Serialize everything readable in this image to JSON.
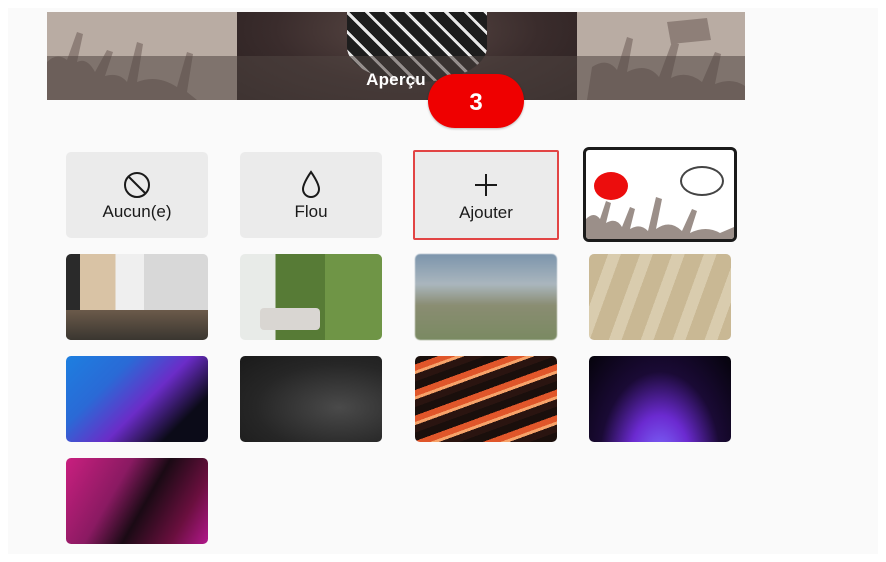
{
  "preview": {
    "label": "Aperçu"
  },
  "step_badge": "3",
  "options": [
    {
      "name": "none",
      "label": "Aucun(e)",
      "icon": "no-symbol-icon"
    },
    {
      "name": "blur",
      "label": "Flou",
      "icon": "droplet-icon"
    },
    {
      "name": "add",
      "label": "Ajouter",
      "icon": "plus-icon"
    }
  ],
  "backgrounds": [
    "custom-protest-image",
    "living-room",
    "forest-room",
    "blurred-mountains",
    "shadow-wall",
    "blue-purple-waves",
    "dark-curves",
    "orange-lava",
    "purple-glow",
    "pink-curves"
  ],
  "colors": {
    "accent_red": "#ef0000",
    "selected_border": "#1a1a1a",
    "add_border": "#e24444",
    "option_bg": "#ebebeb"
  }
}
